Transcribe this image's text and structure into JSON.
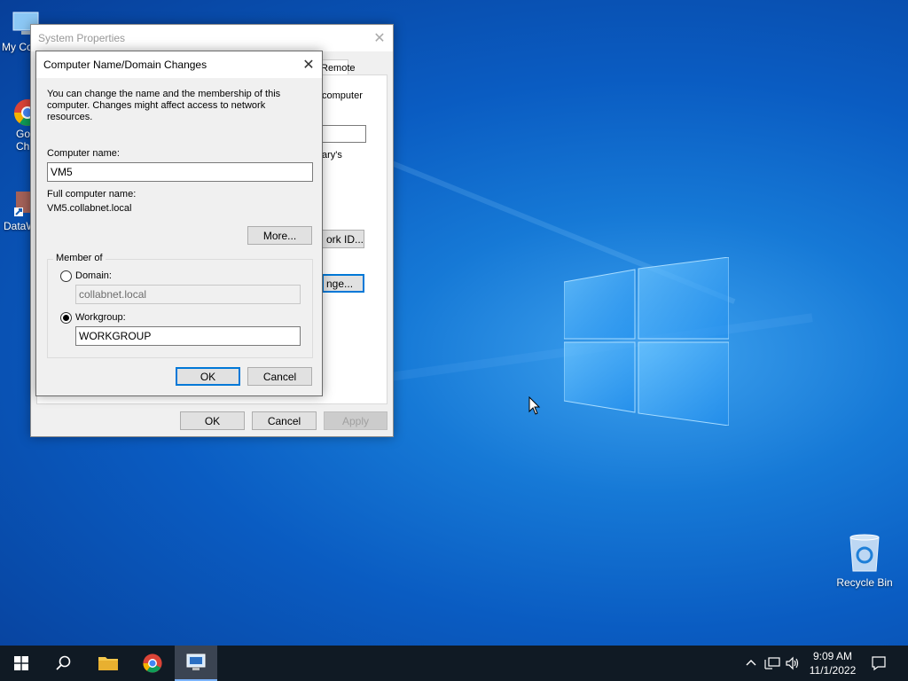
{
  "desktop": {
    "icons": [
      {
        "label": "My Co"
      },
      {
        "label": "Go"
      },
      {
        "label": "Ch"
      },
      {
        "label": "DataW"
      },
      {
        "label": "Recycle Bin"
      }
    ]
  },
  "system_properties": {
    "title": "System Properties",
    "tab_remote": "Remote",
    "text_computer": "computer",
    "text_arys": "ary's",
    "btn_network_id": "ork ID...",
    "btn_change": "nge...",
    "ok": "OK",
    "cancel": "Cancel",
    "apply": "Apply"
  },
  "dialog": {
    "title": "Computer Name/Domain Changes",
    "description": "You can change the name and the membership of this computer. Changes might affect access to network resources.",
    "computer_name_label": "Computer name:",
    "computer_name_value": "VM5",
    "full_name_label": "Full computer name:",
    "full_name_value": "VM5.collabnet.local",
    "more_button": "More...",
    "member_of_label": "Member of",
    "domain_label": "Domain:",
    "domain_value": "collabnet.local",
    "workgroup_label": "Workgroup:",
    "workgroup_value": "WORKGROUP",
    "ok": "OK",
    "cancel": "Cancel"
  },
  "taskbar": {
    "time": "9:09 AM",
    "date": "11/1/2022"
  },
  "colors": {
    "accent": "#0078d7",
    "taskbar": "#101a24"
  }
}
